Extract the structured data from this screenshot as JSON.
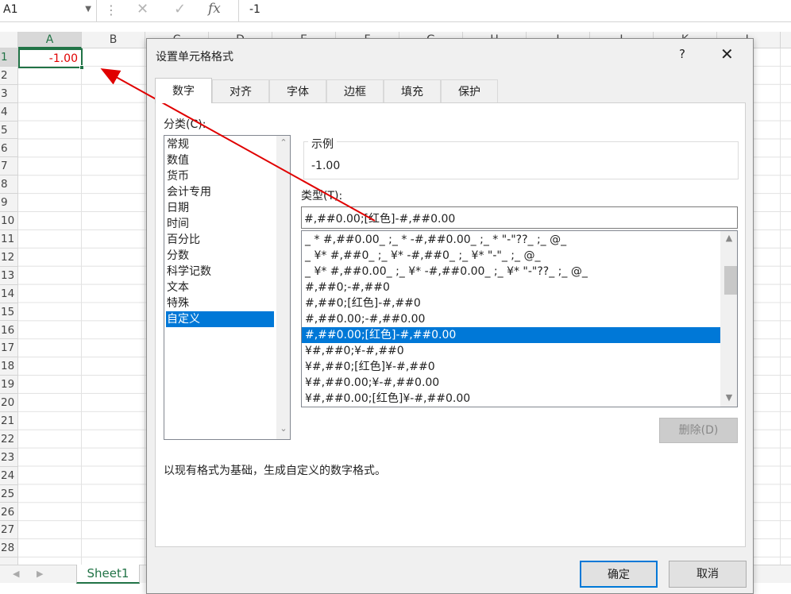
{
  "formula_bar": {
    "name_box": "A1",
    "cancel_icon": "✕",
    "confirm_icon": "✓",
    "fx_label": "fx",
    "formula": "-1"
  },
  "grid": {
    "columns": [
      "A",
      "B",
      "C",
      "D",
      "E",
      "F",
      "G",
      "H",
      "I",
      "J",
      "K",
      "L"
    ],
    "rows": [
      "1",
      "2",
      "3",
      "4",
      "5",
      "6",
      "7",
      "8",
      "9",
      "10",
      "11",
      "12",
      "13",
      "14",
      "15",
      "16",
      "17",
      "18",
      "19",
      "20",
      "21",
      "22",
      "23",
      "24",
      "25",
      "26",
      "27",
      "28"
    ],
    "a1_value": "-1.00",
    "a1_color": "#e00000",
    "accent_color": "#217346"
  },
  "sheet_tabs": {
    "active": "Sheet1"
  },
  "dialog": {
    "title": "设置单元格格式",
    "help": "?",
    "close": "✕",
    "tabs": [
      "数字",
      "对齐",
      "字体",
      "边框",
      "填充",
      "保护"
    ],
    "active_tab": "数字",
    "category_label": "分类(C):",
    "categories": [
      "常规",
      "数值",
      "货币",
      "会计专用",
      "日期",
      "时间",
      "百分比",
      "分数",
      "科学记数",
      "文本",
      "特殊",
      "自定义"
    ],
    "selected_category": "自定义",
    "sample_label": "示例",
    "sample_value": "-1.00",
    "type_label": "类型(T):",
    "type_value": "#,##0.00;[红色]-#,##0.00",
    "formats": [
      "_ * #,##0.00_ ;_ * -#,##0.00_ ;_ * \"-\"??_ ;_ @_",
      "_ ¥* #,##0_ ;_ ¥* -#,##0_ ;_ ¥* \"-\"_ ;_ @_",
      "_ ¥* #,##0.00_ ;_ ¥* -#,##0.00_ ;_ ¥* \"-\"??_ ;_ @_",
      "#,##0;-#,##0",
      "#,##0;[红色]-#,##0",
      "#,##0.00;-#,##0.00",
      "#,##0.00;[红色]-#,##0.00",
      "¥#,##0;¥-#,##0",
      "¥#,##0;[红色]¥-#,##0",
      "¥#,##0.00;¥-#,##0.00",
      "¥#,##0.00;[红色]¥-#,##0.00"
    ],
    "selected_format_index": 6,
    "delete_button": "删除(D)",
    "description": "以现有格式为基础，生成自定义的数字格式。",
    "ok_button": "确定",
    "cancel_button": "取消",
    "selection_color": "#0078d7"
  }
}
